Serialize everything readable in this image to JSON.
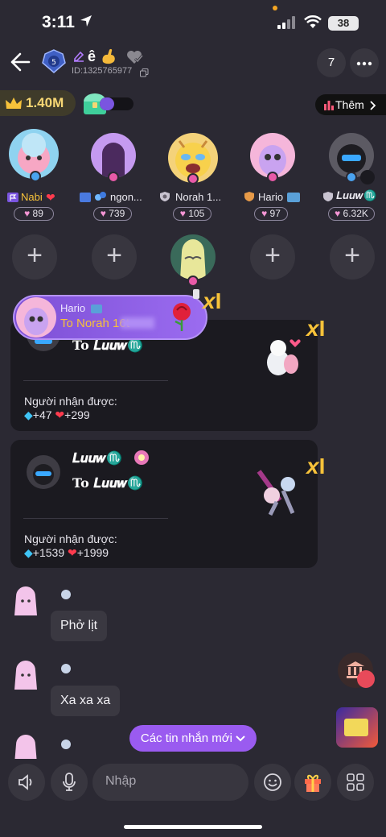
{
  "status": {
    "time": "3:11",
    "battery": "38"
  },
  "room": {
    "name": "ê",
    "id": "ID:1325765977",
    "member_count": "7"
  },
  "wealth": {
    "crown_value": "1.40M",
    "them_label": "Thêm"
  },
  "seats": [
    {
      "name": "Nabi",
      "count": "89"
    },
    {
      "name": "ngon...",
      "count": "739"
    },
    {
      "name": "Norah 1...",
      "count": "105"
    },
    {
      "name": "Hario",
      "count": "97"
    },
    {
      "name": "𝑳𝒖𝒖𝒘♏",
      "count": "6.32K"
    }
  ],
  "toast": {
    "sender": "Hario",
    "text": "To Norah 16t"
  },
  "gift_cards": [
    {
      "to_label": "To 𝑳𝒖𝒖𝒘♏",
      "recv_label": "Người nhận được:",
      "diamond": "+47",
      "heart": "+299"
    },
    {
      "sender": "𝑳𝒖𝒖𝒘♏",
      "to_label": "To 𝑳𝒖𝒖𝒘♏",
      "recv_label": "Người nhận được:",
      "diamond": "+1539",
      "heart": "+1999"
    }
  ],
  "messages": [
    {
      "text": "Phở lịt"
    },
    {
      "text": "Xa xa xa"
    }
  ],
  "new_messages_label": "Các tin nhắn mới",
  "input": {
    "placeholder": "Nhập"
  },
  "colors": {
    "accent": "#9a5bf0",
    "background": "#2b2933",
    "gold": "#f7c23a"
  }
}
